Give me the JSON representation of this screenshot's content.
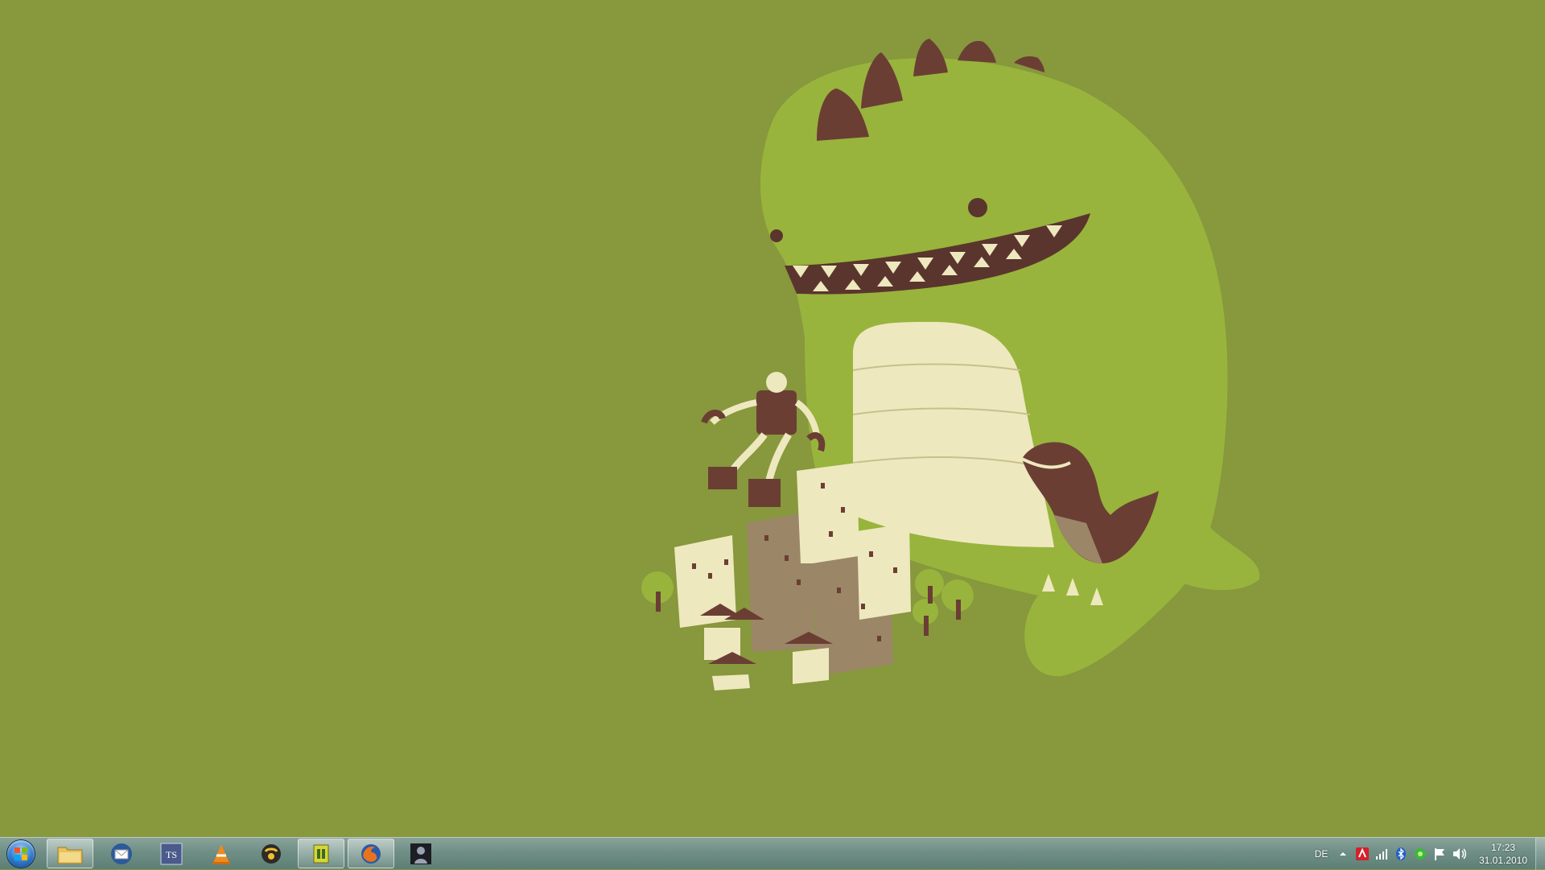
{
  "desktop": {
    "background_color": "#87983d",
    "wallpaper": "giant green dinosaur, small dinosaur, robot and city illustration"
  },
  "taskbar": {
    "start_icon": "windows-orb-icon",
    "pinned": [
      {
        "icon": "folder-icon"
      },
      {
        "icon": "thunderbird-icon"
      },
      {
        "icon": "teamspeak-icon"
      },
      {
        "icon": "vlc-icon"
      },
      {
        "icon": "audio-app-icon"
      },
      {
        "icon": "network-app-icon"
      },
      {
        "icon": "firefox-icon"
      },
      {
        "icon": "game-app-icon"
      }
    ],
    "tray": {
      "language": "DE",
      "icons": [
        "show-hidden-icons-arrow-icon",
        "antivirus-icon",
        "network-signal-icon",
        "bluetooth-icon",
        "app-tray-icon",
        "action-center-flag-icon",
        "volume-icon"
      ],
      "time": "17:23",
      "date": "31.01.2010"
    }
  }
}
